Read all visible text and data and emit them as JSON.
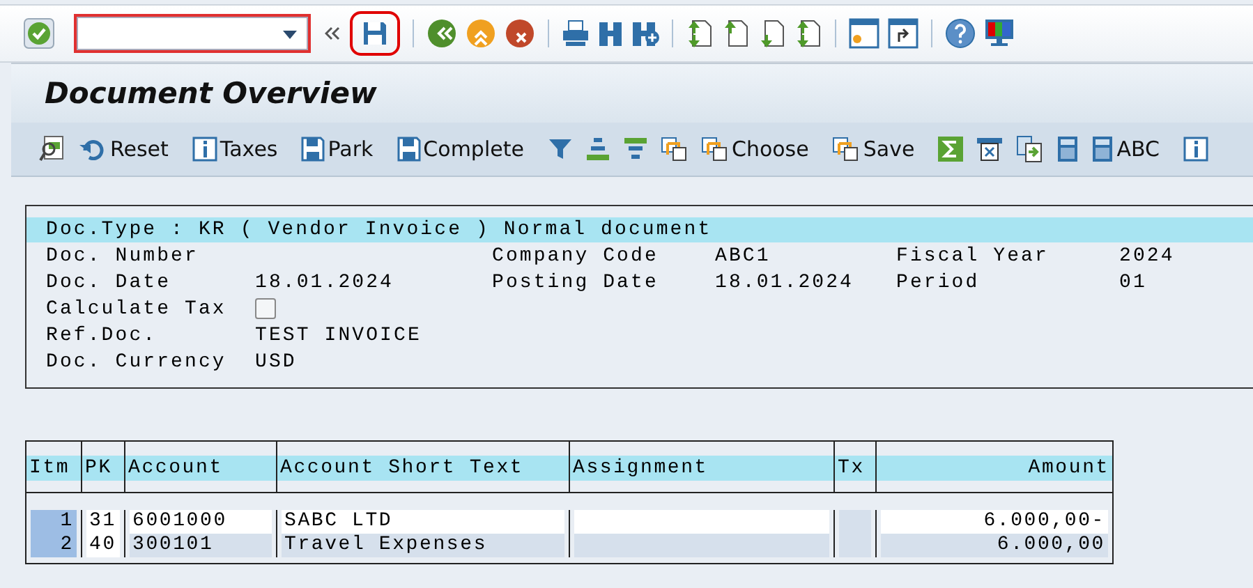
{
  "command_bar": {
    "save_highlighted": true
  },
  "title": "Document Overview",
  "app_toolbar": {
    "buttons": [
      "Reset",
      "Taxes",
      "Park",
      "Complete",
      "Choose",
      "Save",
      "ABC"
    ]
  },
  "header": {
    "doc_type": "Doc.Type : KR ( Vendor Invoice ) Normal document",
    "rows": [
      {
        "cells": [
          {
            "label": "Doc. Number"
          },
          {
            "label": "Company Code",
            "value": "ABC1"
          },
          {
            "label": "Fiscal Year",
            "value": "2024"
          }
        ]
      },
      {
        "cells": [
          {
            "label": "Doc. Date",
            "value": "18.01.2024"
          },
          {
            "label": "Posting Date",
            "value": "18.01.2024"
          },
          {
            "label": "Period",
            "value": "01"
          }
        ]
      },
      {
        "cells": [
          {
            "label": "Calculate Tax",
            "kind": "checkbox",
            "checked": false
          }
        ]
      },
      {
        "cells": [
          {
            "label": "Ref.Doc.",
            "value": "TEST INVOICE"
          }
        ]
      },
      {
        "cells": [
          {
            "label": "Doc. Currency",
            "value": "USD"
          }
        ]
      }
    ]
  },
  "table": {
    "columns": [
      "Itm",
      "PK",
      "Account",
      "Account Short Text",
      "Assignment",
      "Tx",
      "Amount"
    ],
    "rows": [
      {
        "editable": true,
        "cells": [
          "1",
          "31",
          "6001000",
          "SABC LTD",
          "",
          "",
          "6.000,00-"
        ]
      },
      {
        "editable": false,
        "cells": [
          "2",
          "40",
          "300101",
          "Travel Expenses",
          "",
          "",
          "6.000,00"
        ]
      }
    ]
  }
}
